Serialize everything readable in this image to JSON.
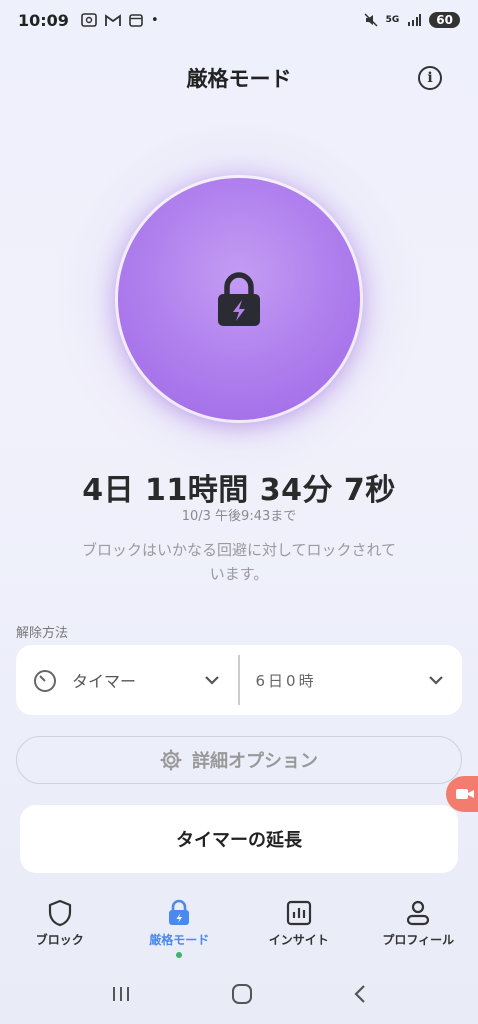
{
  "status_bar": {
    "time": "10:09",
    "battery": "60",
    "network": "5G"
  },
  "header": {
    "title": "厳格モード"
  },
  "lock": {
    "remaining": "4日 11時間 34分 7秒",
    "until": "10/3 午後9:43まで",
    "description": "ブロックはいかなる回避に対してロックされています。"
  },
  "unlock": {
    "section_label": "解除方法",
    "method": "タイマー",
    "duration": "6日0時"
  },
  "options": {
    "label": "詳細オプション"
  },
  "extend": {
    "label": "タイマーの延長"
  },
  "nav": {
    "items": [
      {
        "label": "ブロック",
        "icon": "shield-icon"
      },
      {
        "label": "厳格モード",
        "icon": "lock-icon",
        "active": true
      },
      {
        "label": "インサイト",
        "icon": "chart-icon"
      },
      {
        "label": "プロフィール",
        "icon": "person-icon"
      }
    ]
  },
  "colors": {
    "accent": "#4a8af0",
    "lock_purple": "#b182ee",
    "active_dot": "#3bb46e"
  }
}
